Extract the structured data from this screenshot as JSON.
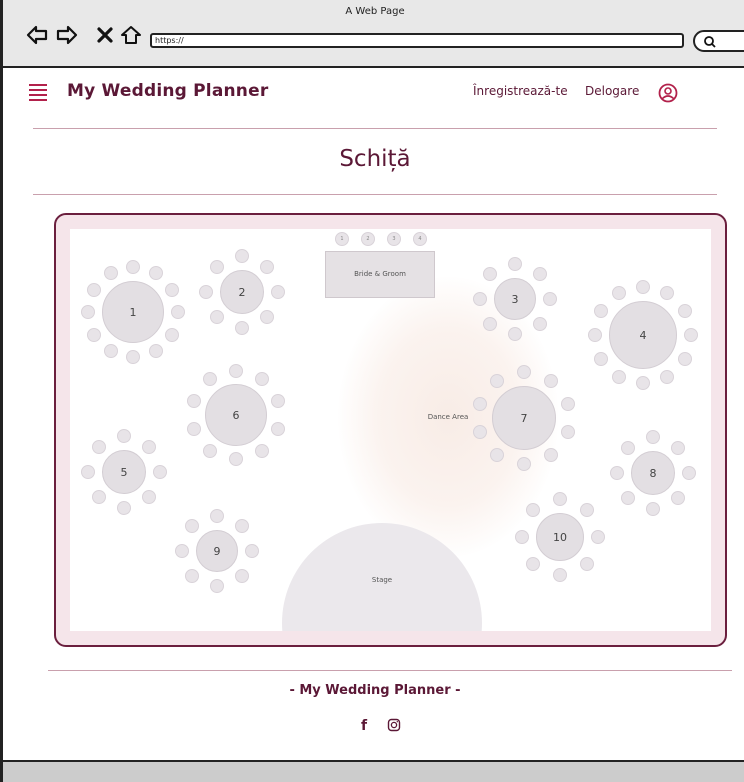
{
  "window": {
    "title": "A Web Page",
    "url": "https://"
  },
  "header": {
    "brand": "My Wedding Planner",
    "nav": {
      "register": "Înregistrează-te",
      "logout": "Delogare"
    }
  },
  "page": {
    "title": "Schiță"
  },
  "floorplan": {
    "bride_table": "Bride & Groom",
    "dance_area": "Dance Area",
    "stage": "Stage",
    "tables": [
      "1",
      "2",
      "3",
      "4",
      "5",
      "6",
      "7",
      "8",
      "9",
      "10"
    ],
    "top_seats": [
      "1",
      "2",
      "3",
      "4"
    ]
  },
  "footer": {
    "text": "- My Wedding Planner -"
  },
  "icons": {
    "back": "arrow-left-icon",
    "forward": "arrow-right-icon",
    "close": "close-icon",
    "home": "home-icon",
    "search": "search-icon",
    "menu": "hamburger-icon",
    "user": "user-circle-icon",
    "facebook": "facebook-icon",
    "instagram": "instagram-icon"
  },
  "colors": {
    "brand": "#5b1836",
    "accent": "#b2214b",
    "frame": "#6b1f3e"
  }
}
